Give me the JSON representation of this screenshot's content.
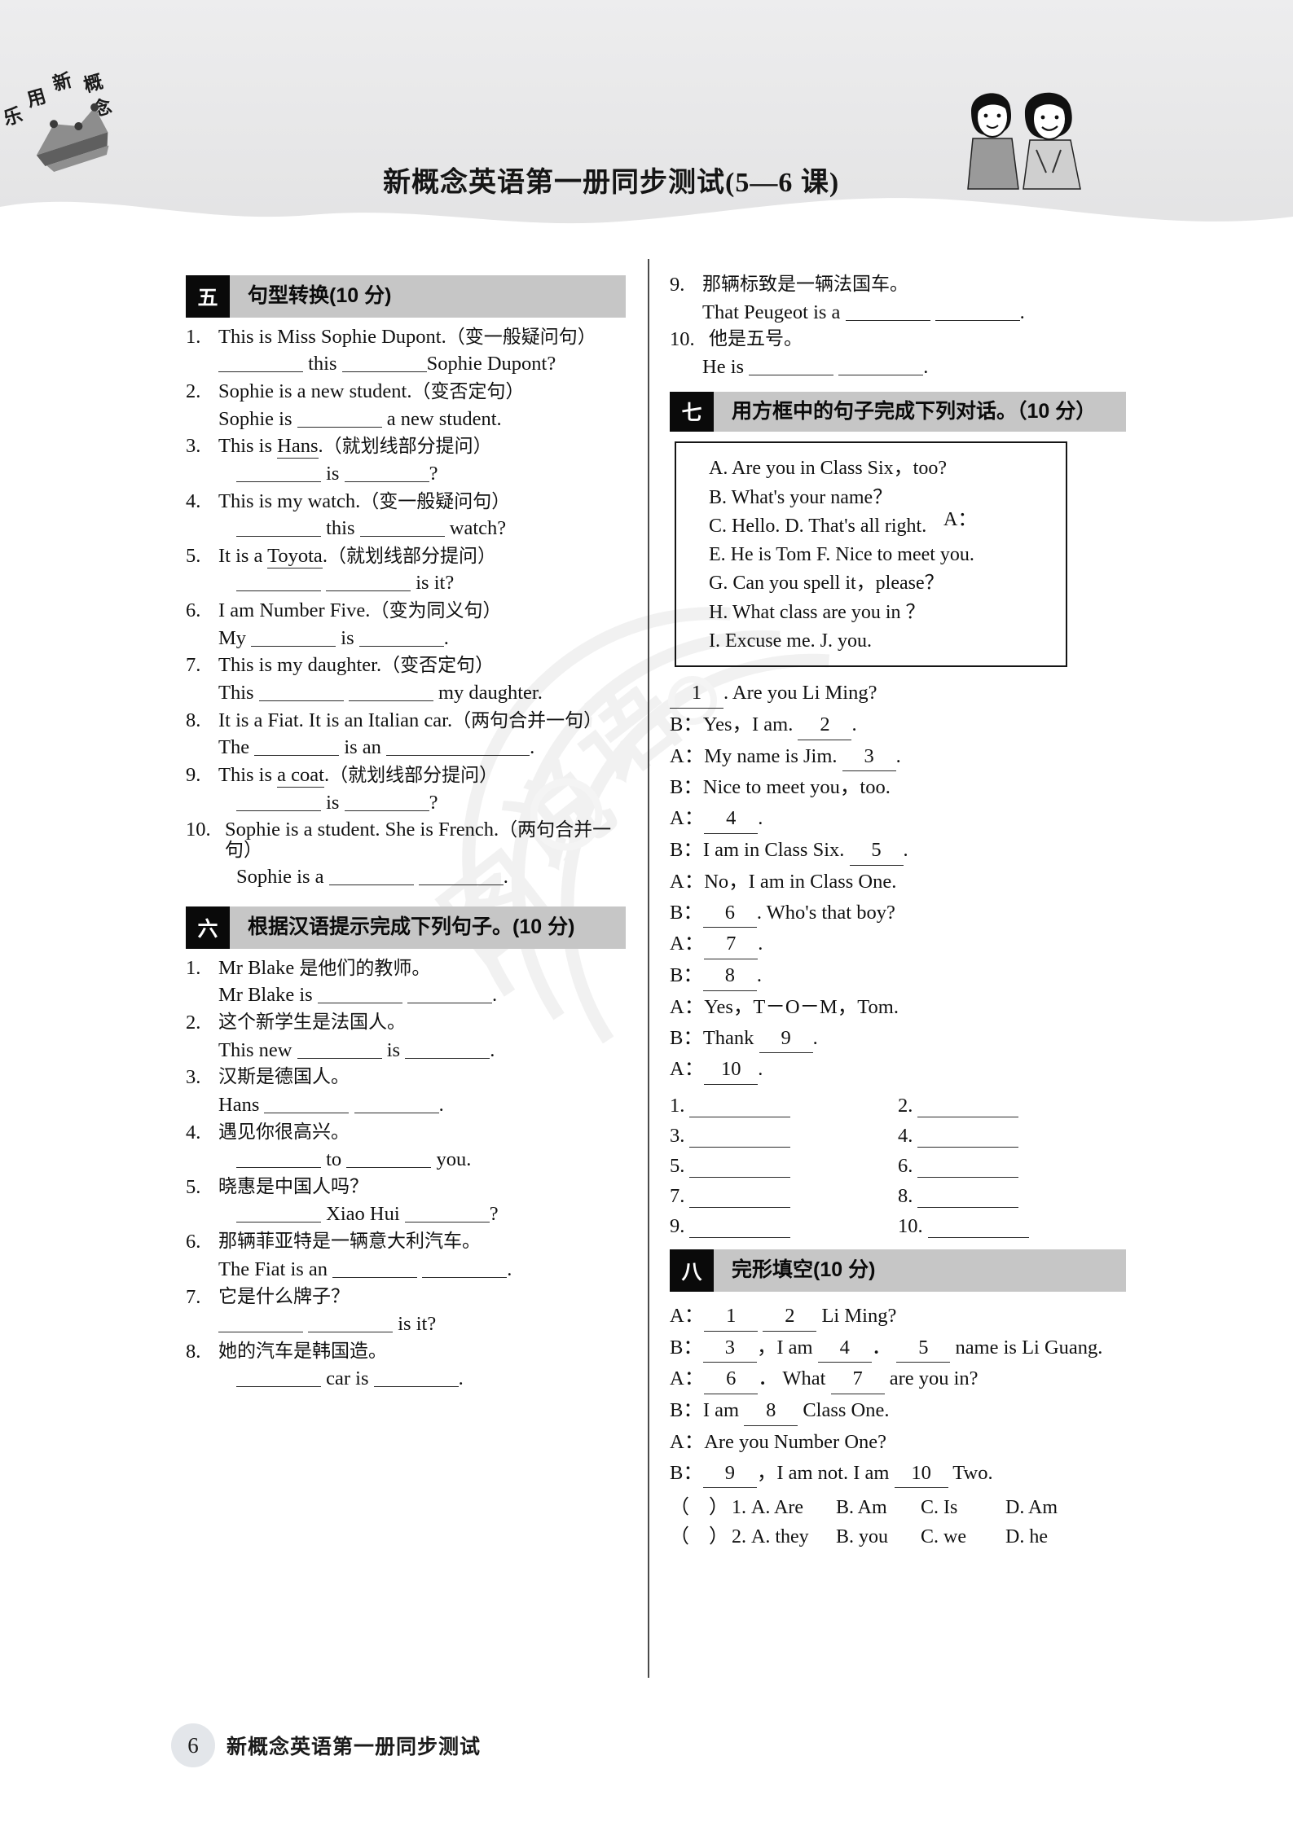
{
  "header": {
    "title": "新概念英语第一册同步测试(5—6 课)",
    "logo_text": "乐用新概念",
    "logo_icon": "book-crown-logo",
    "kids_icon": "two-students-illustration"
  },
  "watermark": {
    "text": "图说语"
  },
  "section5": {
    "num": "五",
    "title": "句型转换(10 分)",
    "items": [
      {
        "n": "1.",
        "prompt": "This is Miss Sophie Dupont.（变一般疑问句）",
        "answer_line": "______ this ______Sophie Dupont?"
      },
      {
        "n": "2.",
        "prompt": "Sophie is a new student.（变否定句）",
        "answer_line": "Sophie is ________ a new student."
      },
      {
        "n": "3.",
        "prompt": "This is Hans.（就划线部分提问）",
        "answer_line": "________ is ________?"
      },
      {
        "n": "4.",
        "prompt": "This is my watch.（变一般疑问句）",
        "answer_line": "________ this ________ watch?"
      },
      {
        "n": "5.",
        "prompt": "It is a Toyota.（就划线部分提问）",
        "answer_line": "________ ________ is it?"
      },
      {
        "n": "6.",
        "prompt": "I am Number Five.（变为同义句）",
        "answer_line": "My ________ is ________."
      },
      {
        "n": "7.",
        "prompt": "This is my daughter.（变否定句）",
        "answer_line": "This ________ ________ my daughter."
      },
      {
        "n": "8.",
        "prompt": "It is a Fiat. It is an Italian car.（两句合并一句）",
        "answer_line": "The ________ is an ________ ________."
      },
      {
        "n": "9.",
        "prompt": "This is a coat.（就划线部分提问）",
        "answer_line": "________ is ________?"
      },
      {
        "n": "10.",
        "prompt": "Sophie is a student. She is French.（两句合并一句）",
        "answer_line": "Sophie is a ________ ________."
      }
    ],
    "underlined": {
      "q3": "Hans",
      "q5": "Toyota",
      "q9": "a coat"
    }
  },
  "section6": {
    "num": "六",
    "title": "根据汉语提示完成下列句子。(10 分)",
    "items": [
      {
        "n": "1.",
        "prompt": "Mr Blake 是他们的教师。",
        "answer_line": "Mr Blake is ________ ________."
      },
      {
        "n": "2.",
        "prompt": "这个新学生是法国人。",
        "answer_line": "This new ________ is ________."
      },
      {
        "n": "3.",
        "prompt": "汉斯是德国人。",
        "answer_line": "Hans ________ ________."
      },
      {
        "n": "4.",
        "prompt": "遇见你很高兴。",
        "answer_line": "________ to ________ you."
      },
      {
        "n": "5.",
        "prompt": "晓惠是中国人吗？",
        "answer_line": "________ Xiao Hui ________?"
      },
      {
        "n": "6.",
        "prompt": "那辆菲亚特是一辆意大利汽车。",
        "answer_line": "The Fiat is an ________ ________."
      },
      {
        "n": "7.",
        "prompt": "它是什么牌子？",
        "answer_line": "________ ________ is it?"
      },
      {
        "n": "8.",
        "prompt": "她的汽车是韩国造。",
        "answer_line": "________ car is ________."
      },
      {
        "n": "9.",
        "prompt": "那辆标致是一辆法国车。",
        "answer_line": "That Peugeot is a ________ ________."
      },
      {
        "n": "10.",
        "prompt": "他是五号。",
        "answer_line": "He is ________ ________."
      }
    ]
  },
  "section7": {
    "num": "七",
    "title": "用方框中的句子完成下列对话。（10 分）",
    "box_options": [
      "A. Are you in Class Six，too?",
      "B. What's your name？",
      "C. Hello.    D. That's all right.",
      "E. He is Tom   F. Nice to meet you.",
      "G. Can you spell it，please？",
      "H. What class are you in ？",
      "I. Excuse me.    J. you."
    ],
    "outside_label": "A：",
    "dialogue": [
      {
        "speaker": "",
        "text_before": "",
        "blank": "1",
        "text_after": ". Are you Li Ming?"
      },
      {
        "speaker": "B：",
        "text_before": "Yes，I am. ",
        "blank": "2",
        "text_after": "."
      },
      {
        "speaker": "A：",
        "text_before": "My name is Jim. ",
        "blank": "3",
        "text_after": "."
      },
      {
        "speaker": "B：",
        "text_before": "Nice to meet you，too.",
        "blank": "",
        "text_after": ""
      },
      {
        "speaker": "A：",
        "text_before": "",
        "blank": "4",
        "text_after": "."
      },
      {
        "speaker": "B：",
        "text_before": "I am in Class Six. ",
        "blank": "5",
        "text_after": "."
      },
      {
        "speaker": "A：",
        "text_before": "No，I am in Class One.",
        "blank": "",
        "text_after": ""
      },
      {
        "speaker": "B：",
        "text_before": "",
        "blank": "6",
        "text_after": ". Who's that boy?"
      },
      {
        "speaker": "A：",
        "text_before": "",
        "blank": "7",
        "text_after": "."
      },
      {
        "speaker": "B：",
        "text_before": "",
        "blank": "8",
        "text_after": "."
      },
      {
        "speaker": "A：",
        "text_before": "Yes，T－O－M，Tom.",
        "blank": "",
        "text_after": ""
      },
      {
        "speaker": "B：",
        "text_before": "Thank ",
        "blank": "9",
        "text_after": "."
      },
      {
        "speaker": "A：",
        "text_before": "",
        "blank": "10",
        "text_after": "."
      }
    ],
    "answer_slots": [
      "1.",
      "2.",
      "3.",
      "4.",
      "5.",
      "6.",
      "7.",
      "8.",
      "9.",
      "10."
    ]
  },
  "section8": {
    "num": "八",
    "title": "完形填空(10 分)",
    "dialogue": [
      {
        "speaker": "A：",
        "parts": [
          "",
          "1",
          "  ",
          "2",
          " Li Ming?"
        ]
      },
      {
        "speaker": "B：",
        "parts": [
          "",
          "3",
          "，I am ",
          "4",
          "． ",
          "5",
          " name is Li Guang."
        ]
      },
      {
        "speaker": "A：",
        "parts": [
          "",
          "6",
          "． What ",
          "7",
          " are you in?"
        ]
      },
      {
        "speaker": "B：",
        "parts": [
          "I am ",
          "8",
          " Class One."
        ]
      },
      {
        "speaker": "A：",
        "parts": [
          "Are you Number One?"
        ]
      },
      {
        "speaker": "B：",
        "parts": [
          "",
          "9",
          "，I am not. I am ",
          "10",
          " Two."
        ]
      }
    ],
    "choices": [
      {
        "n": "1.",
        "options": [
          "A. Are",
          "B. Am",
          "C. Is",
          "D. Am"
        ]
      },
      {
        "n": "2.",
        "options": [
          "A. they",
          "B. you",
          "C. we",
          "D. he"
        ]
      }
    ]
  },
  "footer": {
    "page_number": "6",
    "text": "新概念英语第一册同步测试"
  }
}
